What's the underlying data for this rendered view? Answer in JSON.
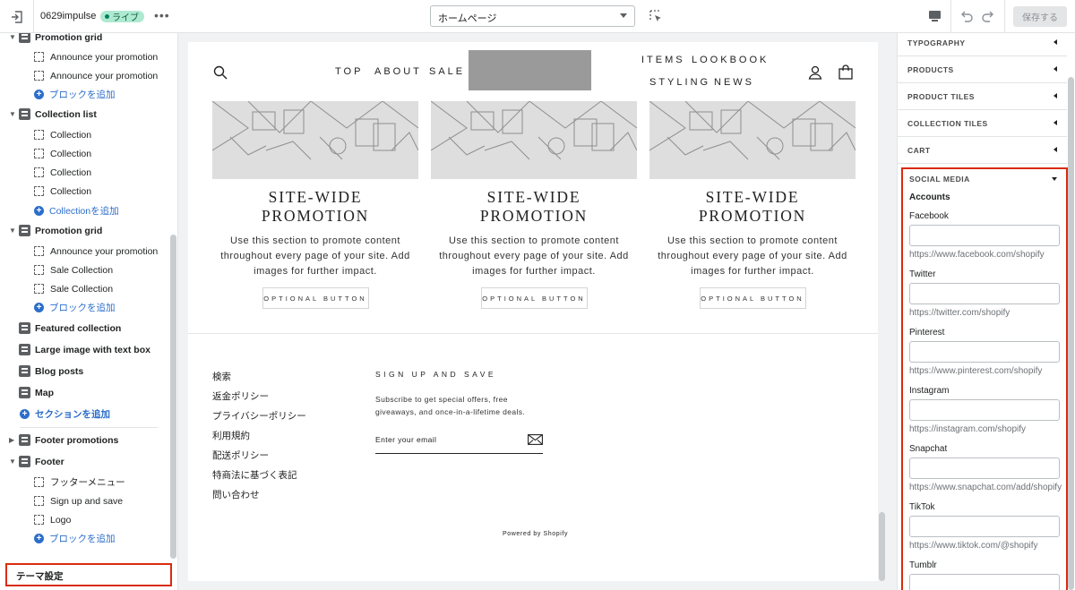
{
  "topbar": {
    "store_name": "0629impulse",
    "live_badge": "ライブ",
    "page_select": "ホームページ",
    "save_label": "保存する"
  },
  "sidebar": {
    "rows": [
      {
        "kind": "section",
        "label": "Promotion grid",
        "expanded": true
      },
      {
        "kind": "block",
        "label": "Announce your promotion"
      },
      {
        "kind": "block",
        "label": "Announce your promotion"
      },
      {
        "kind": "add",
        "label": "ブロックを追加"
      },
      {
        "kind": "section",
        "label": "Collection list",
        "expanded": true
      },
      {
        "kind": "block",
        "label": "Collection"
      },
      {
        "kind": "block",
        "label": "Collection"
      },
      {
        "kind": "block",
        "label": "Collection"
      },
      {
        "kind": "block",
        "label": "Collection"
      },
      {
        "kind": "add",
        "label": "Collectionを追加"
      },
      {
        "kind": "section",
        "label": "Promotion grid",
        "expanded": true
      },
      {
        "kind": "block",
        "label": "Announce your promotion"
      },
      {
        "kind": "block",
        "label": "Sale Collection"
      },
      {
        "kind": "block",
        "label": "Sale Collection"
      },
      {
        "kind": "add",
        "label": "ブロックを追加"
      },
      {
        "kind": "section",
        "label": "Featured collection",
        "icon": "tag-icon"
      },
      {
        "kind": "section",
        "label": "Large image with text box",
        "icon": "image-text-icon"
      },
      {
        "kind": "section",
        "label": "Blog posts",
        "icon": "blog-icon"
      },
      {
        "kind": "section",
        "label": "Map",
        "icon": "map-pin-icon"
      },
      {
        "kind": "add-section",
        "label": "セクションを追加"
      },
      {
        "kind": "section",
        "label": "Footer promotions",
        "expanded": false
      },
      {
        "kind": "section",
        "label": "Footer",
        "expanded": true
      },
      {
        "kind": "block",
        "label": "フッターメニュー"
      },
      {
        "kind": "block",
        "label": "Sign up and save"
      },
      {
        "kind": "block",
        "label": "Logo"
      },
      {
        "kind": "add",
        "label": "ブロックを追加"
      }
    ],
    "theme_settings": "テーマ設定"
  },
  "preview": {
    "nav": {
      "left_links": [
        "TOP",
        "ABOUT",
        "SALE"
      ],
      "right_links_top": [
        "ITEMS",
        "LOOKBOOK"
      ],
      "right_links_bottom": [
        "STYLING",
        "NEWS"
      ]
    },
    "promos": [
      {
        "title": "SITE-WIDE PROMOTION",
        "text": "Use this section to promote content throughout every page of your site. Add images for further impact.",
        "button": "OPTIONAL BUTTON"
      },
      {
        "title": "SITE-WIDE PROMOTION",
        "text": "Use this section to promote content throughout every page of your site. Add images for further impact.",
        "button": "OPTIONAL BUTTON"
      },
      {
        "title": "SITE-WIDE PROMOTION",
        "text": "Use this section to promote content throughout every page of your site. Add images for further impact.",
        "button": "OPTIONAL BUTTON"
      }
    ],
    "footer": {
      "menu": [
        "検索",
        "返金ポリシー",
        "プライバシーポリシー",
        "利用規約",
        "配送ポリシー",
        "特商法に基づく表記",
        "問い合わせ"
      ],
      "signup_title": "SIGN UP AND SAVE",
      "signup_text": "Subscribe to get special offers, free giveaways, and once-in-a-lifetime deals.",
      "email_placeholder": "Enter your email",
      "powered": "Powered by Shopify"
    }
  },
  "settings": {
    "accordions": [
      "TYPOGRAPHY",
      "PRODUCTS",
      "PRODUCT TILES",
      "COLLECTION TILES",
      "CART"
    ],
    "social_title": "SOCIAL MEDIA",
    "accounts_label": "Accounts",
    "fields": [
      {
        "label": "Facebook",
        "value": "",
        "help": "https://www.facebook.com/shopify"
      },
      {
        "label": "Twitter",
        "value": "",
        "help": "https://twitter.com/shopify"
      },
      {
        "label": "Pinterest",
        "value": "",
        "help": "https://www.pinterest.com/shopify"
      },
      {
        "label": "Instagram",
        "value": "",
        "help": "https://instagram.com/shopify"
      },
      {
        "label": "Snapchat",
        "value": "",
        "help": "https://www.snapchat.com/add/shopify"
      },
      {
        "label": "TikTok",
        "value": "",
        "help": "https://www.tiktok.com/@shopify"
      },
      {
        "label": "Tumblr",
        "value": ""
      }
    ]
  },
  "colors": {
    "accent": "#2c6ecb",
    "highlight": "#d82c0d",
    "live": "#aee9d1"
  }
}
